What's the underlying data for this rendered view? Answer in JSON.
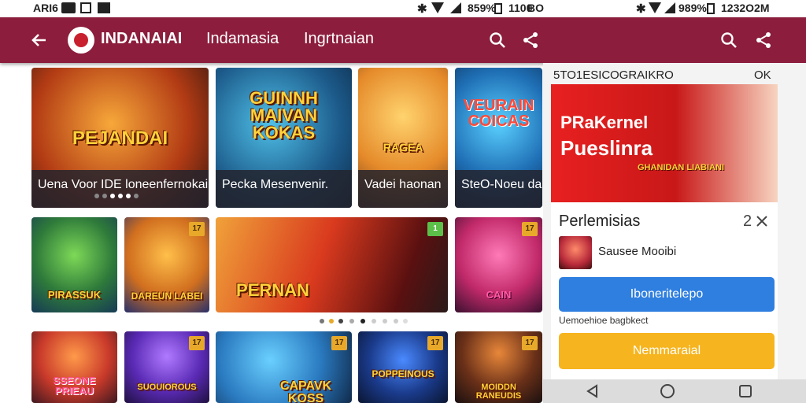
{
  "status_bar": {
    "left_text": "ARI6",
    "center_battery": "859%",
    "center_time": "1100",
    "center_time_suffix": "BO",
    "right_battery": "989%",
    "right_time": "1232O2M"
  },
  "app_bar": {
    "brand": "INDANAIAI",
    "nav_items": [
      "Indamasia",
      "Ingrtnaian"
    ]
  },
  "cards_row1": [
    {
      "art": "PEJANDAI",
      "caption": "Uena Voor IDE loneenfernokai"
    },
    {
      "art": "GUINNH MAIVAN KOKAS",
      "caption": "Pecka Mesenvenir."
    },
    {
      "art": "RAGEA",
      "caption": "Vadei haonan"
    },
    {
      "art": "VEURAIN COICAS",
      "caption": "SteO-Noeu da"
    }
  ],
  "cards_row2": [
    {
      "art": "PIRASSUK"
    },
    {
      "art": "DAREUN LABEI",
      "badge": "17"
    },
    {
      "art": "PERNAN",
      "badge": "1"
    },
    {
      "art": "CAIN",
      "badge": "17"
    }
  ],
  "cards_row3": [
    {
      "art": "SSEONE PRIEAU"
    },
    {
      "art": "SUOUIOROUS",
      "badge": "17"
    },
    {
      "art": "CAPAVK KOSS",
      "badge": "17"
    },
    {
      "art": "POPPEINOUS",
      "badge": "17"
    },
    {
      "art": "MOIDDN RANEUDIS",
      "badge": "17"
    }
  ],
  "side_panel": {
    "header_left": "5TO1ESIC",
    "header_mid": "OGRAIKRO",
    "header_right": "OK",
    "banner_line1": "PRaKernel",
    "banner_line2": "Pueslinra",
    "banner_logo": "GHANIDAN LIABIANI",
    "section_title": "Perlemisias",
    "section_count": "2",
    "item_label": "Sausee Mooibi",
    "blue_button": "Iboneritelepo",
    "sub_text": "Uemoehioe bagbkect",
    "yellow_button": "Nemmaraial"
  },
  "colors": {
    "app_bar": "#8c1d3c",
    "blue_button": "#2f7fe0",
    "yellow_button": "#f6b41e"
  }
}
